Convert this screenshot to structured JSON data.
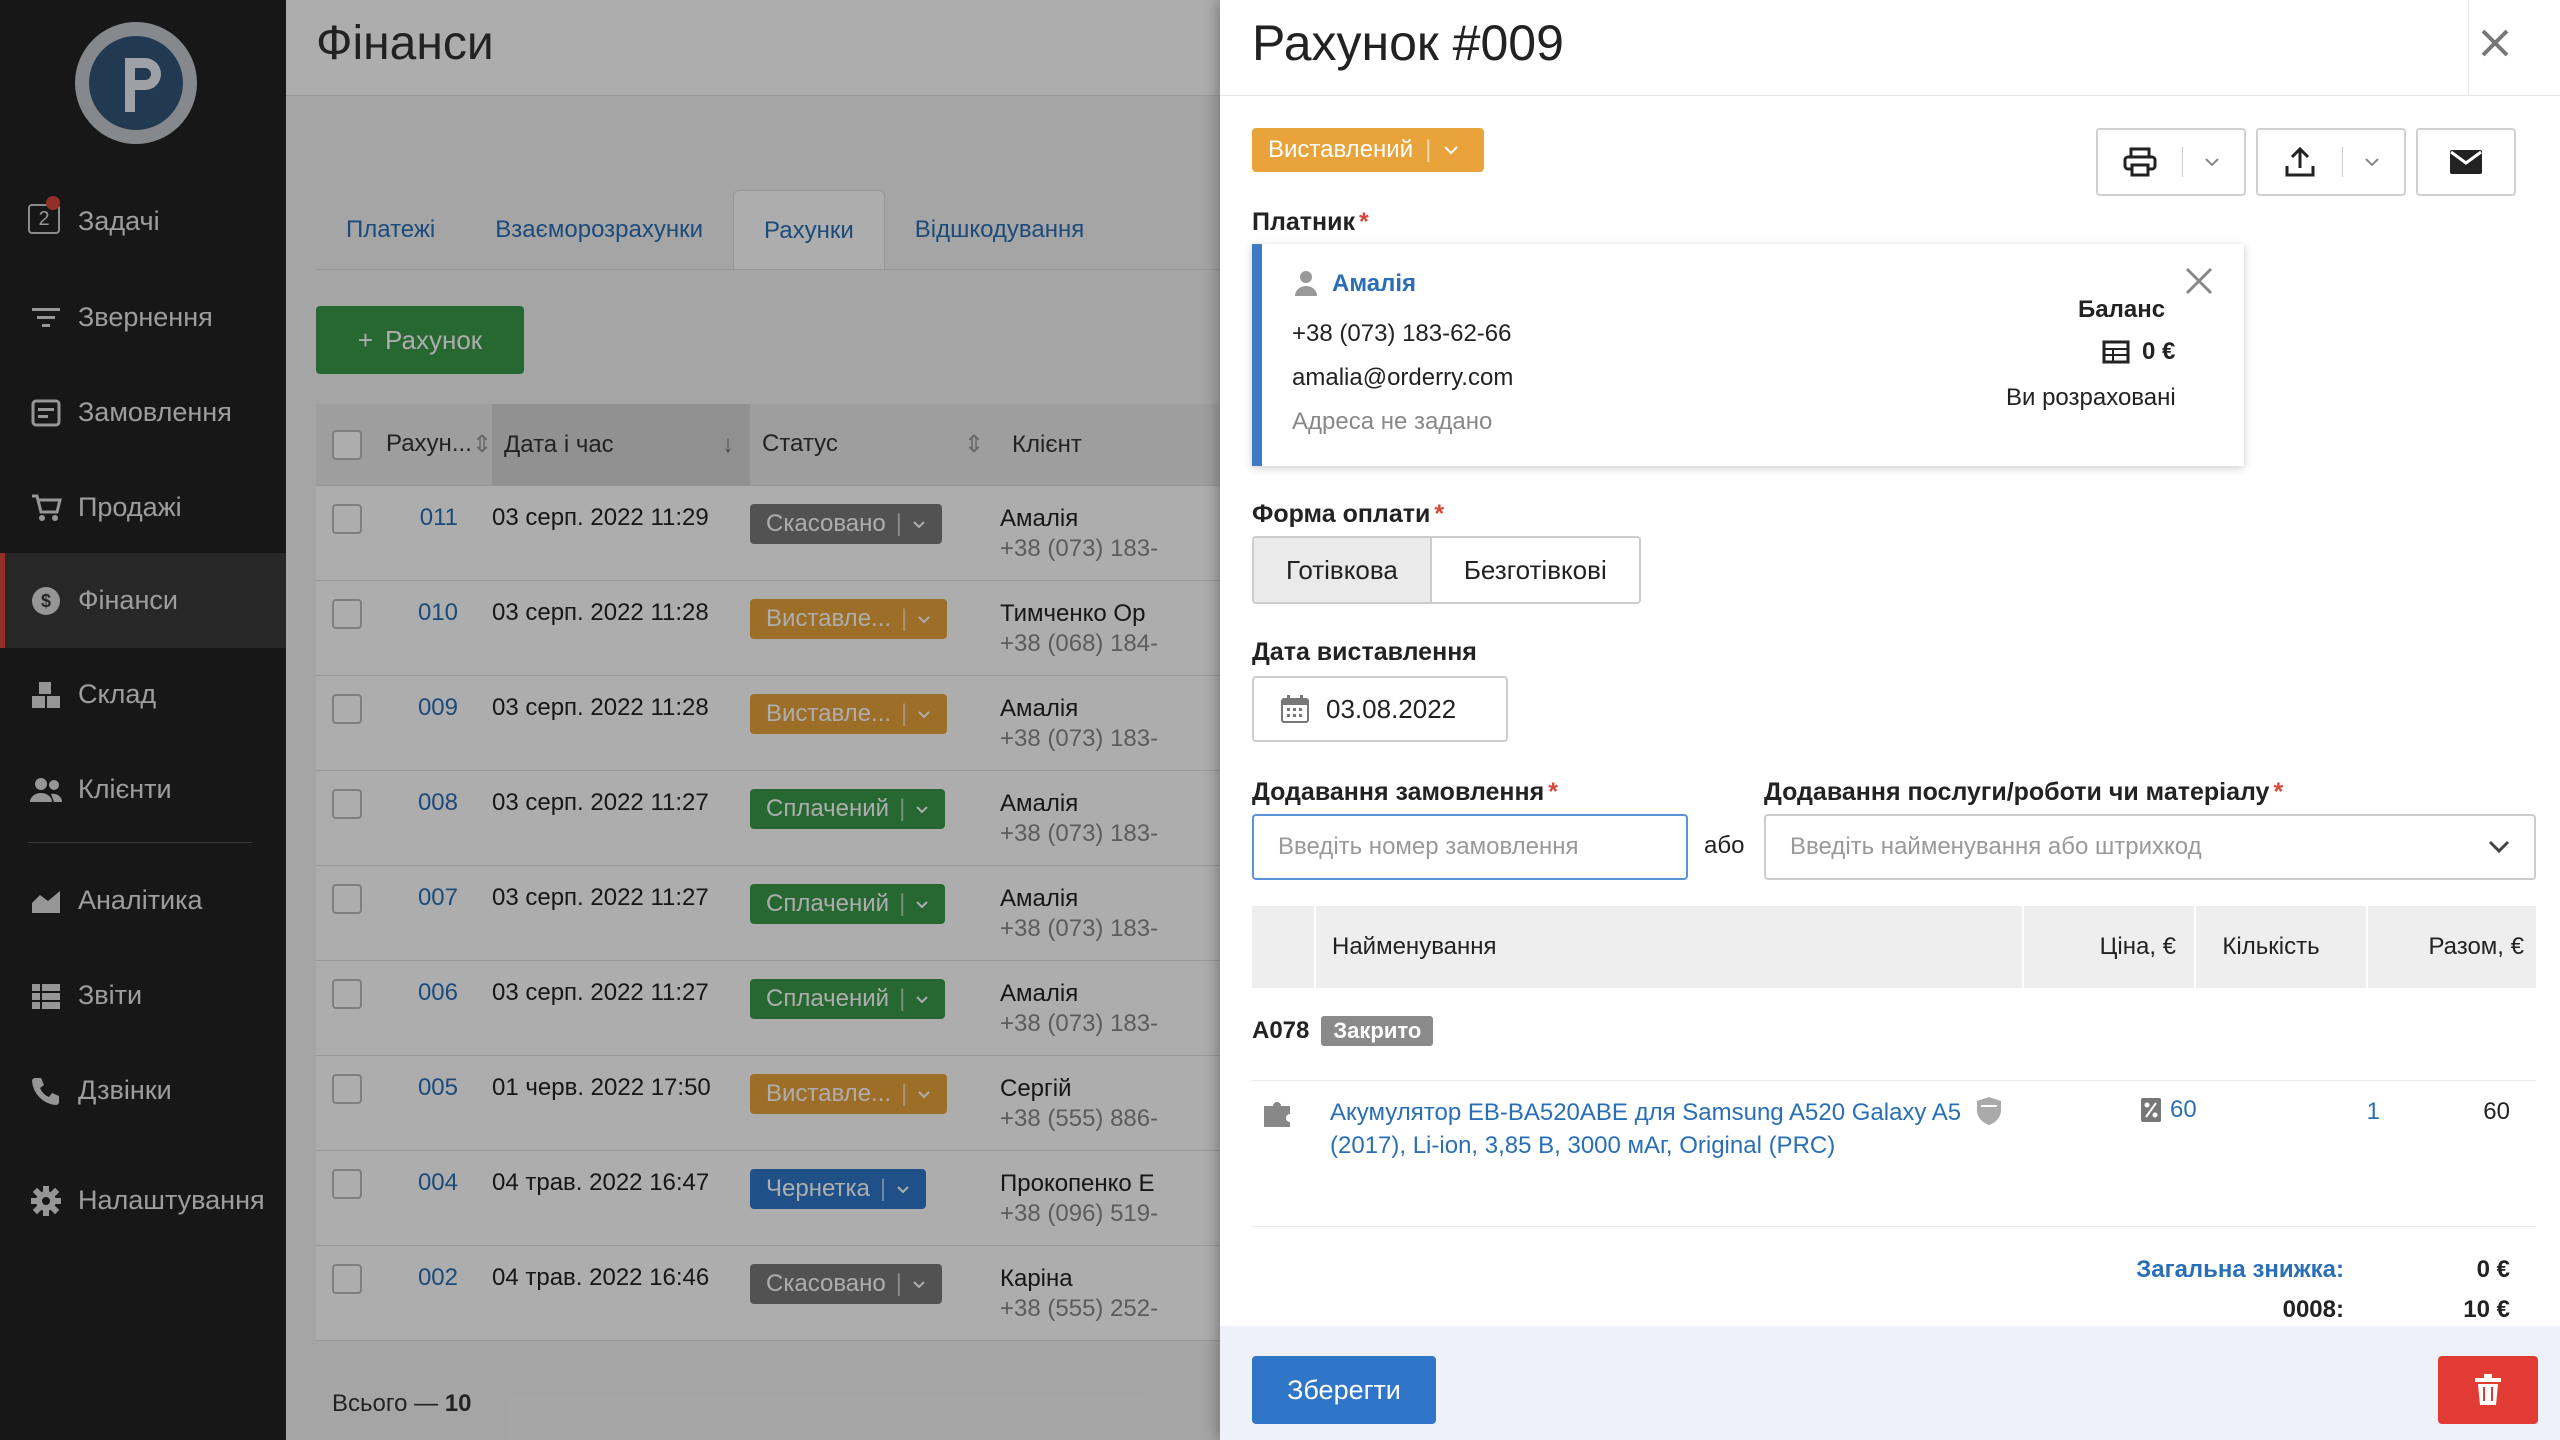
{
  "sidebar": {
    "tasks_badge": "2",
    "items": [
      {
        "label": "Задачі",
        "icon": "tasks-icon"
      },
      {
        "label": "Звернення",
        "icon": "filter-icon"
      },
      {
        "label": "Замовлення",
        "icon": "orders-icon"
      },
      {
        "label": "Продажі",
        "icon": "cart-icon"
      },
      {
        "label": "Фінанси",
        "icon": "dollar-icon",
        "active": true
      },
      {
        "label": "Склад",
        "icon": "warehouse-icon"
      },
      {
        "label": "Клієнти",
        "icon": "users-icon"
      },
      {
        "label": "Аналітика",
        "icon": "analytics-icon"
      },
      {
        "label": "Звіти",
        "icon": "reports-icon"
      },
      {
        "label": "Дзвінки",
        "icon": "phone-icon"
      },
      {
        "label": "Налаштування",
        "icon": "gear-icon"
      }
    ]
  },
  "main": {
    "title": "Фінанси",
    "tabs": [
      "Платежі",
      "Взаєморозрахунки",
      "Рахунки",
      "Відшкодування"
    ],
    "active_tab": "Рахунки",
    "add_button": "Рахунок",
    "table": {
      "headers": [
        "Рахун...",
        "Дата і час",
        "Статус",
        "Клієнт"
      ],
      "rows": [
        {
          "num": "011",
          "date": "03 серп. 2022 11:29",
          "status": "Скасовано",
          "status_color": "#7a7a7a",
          "client": "Амалія",
          "phone": "+38 (073) 183-"
        },
        {
          "num": "010",
          "date": "03 серп. 2022 11:28",
          "status": "Виставле...",
          "status_color": "#e8a33a",
          "client": "Тимченко Ор",
          "phone": "+38 (068) 184-"
        },
        {
          "num": "009",
          "date": "03 серп. 2022 11:28",
          "status": "Виставле...",
          "status_color": "#e8a33a",
          "client": "Амалія",
          "phone": "+38 (073) 183-"
        },
        {
          "num": "008",
          "date": "03 серп. 2022 11:27",
          "status": "Сплачений",
          "status_color": "#3a9a4a",
          "client": "Амалія",
          "phone": "+38 (073) 183-"
        },
        {
          "num": "007",
          "date": "03 серп. 2022 11:27",
          "status": "Сплачений",
          "status_color": "#3a9a4a",
          "client": "Амалія",
          "phone": "+38 (073) 183-"
        },
        {
          "num": "006",
          "date": "03 серп. 2022 11:27",
          "status": "Сплачений",
          "status_color": "#3a9a4a",
          "client": "Амалія",
          "phone": "+38 (073) 183-"
        },
        {
          "num": "005",
          "date": "01 черв. 2022 17:50",
          "status": "Виставле...",
          "status_color": "#e8a33a",
          "client": "Сергій",
          "phone": "+38 (555) 886-"
        },
        {
          "num": "004",
          "date": "04 трав. 2022 16:47",
          "status": "Чернетка",
          "status_color": "#2f76c8",
          "client": "Прокопенко Е",
          "phone": "+38 (096) 519-"
        },
        {
          "num": "002",
          "date": "04 трав. 2022 16:46",
          "status": "Скасовано",
          "status_color": "#7a7a7a",
          "client": "Каріна",
          "phone": "+38 (555) 252-"
        }
      ]
    },
    "total_label": "Всього —",
    "total_value": "10"
  },
  "panel": {
    "title": "Рахунок #009",
    "status": "Виставлений",
    "status_color": "#e8a33a",
    "payer_label": "Платник",
    "payer": {
      "name": "Амалія",
      "phone": "+38 (073) 183-62-66",
      "email": "amalia@orderry.com",
      "address": "Адреса не задано",
      "balance_label": "Баланс",
      "balance_value": "0 €",
      "balance_note": "Ви розраховані"
    },
    "payment_form_label": "Форма оплати",
    "payment_options": [
      "Готівкова",
      "Безготівкові"
    ],
    "payment_selected": "Готівкова",
    "issue_date_label": "Дата виставлення",
    "issue_date": "03.08.2022",
    "add_order_label": "Додавання замовлення",
    "add_order_placeholder": "Введіть номер замовлення",
    "or_text": "або",
    "add_service_label": "Додавання послуги/роботи чи матеріалу",
    "add_service_placeholder": "Введіть найменування або штрихкод",
    "items_headers": {
      "name": "Найменування",
      "price": "Ціна, €",
      "qty": "Кількість",
      "total": "Разом, €"
    },
    "group": {
      "code": "A078",
      "badge": "Закрито"
    },
    "item": {
      "name": "Акумулятор EB-BA520ABE для Samsung A520 Galaxy A5 (2017), Li-ion, 3,85 В, 3000 мАг, Original (PRC)",
      "price": "60",
      "qty": "1",
      "total": "60"
    },
    "discount_label": "Загальна знижка:",
    "discount_value": "0 €",
    "total_label": "0008:",
    "total_value": "10 €",
    "save_button": "Зберегти"
  },
  "colors": {
    "accent": "#2f76c8",
    "danger": "#e23b33",
    "success": "#3a9a4a",
    "warning": "#e8a33a",
    "sidebar_bg": "#222222"
  }
}
